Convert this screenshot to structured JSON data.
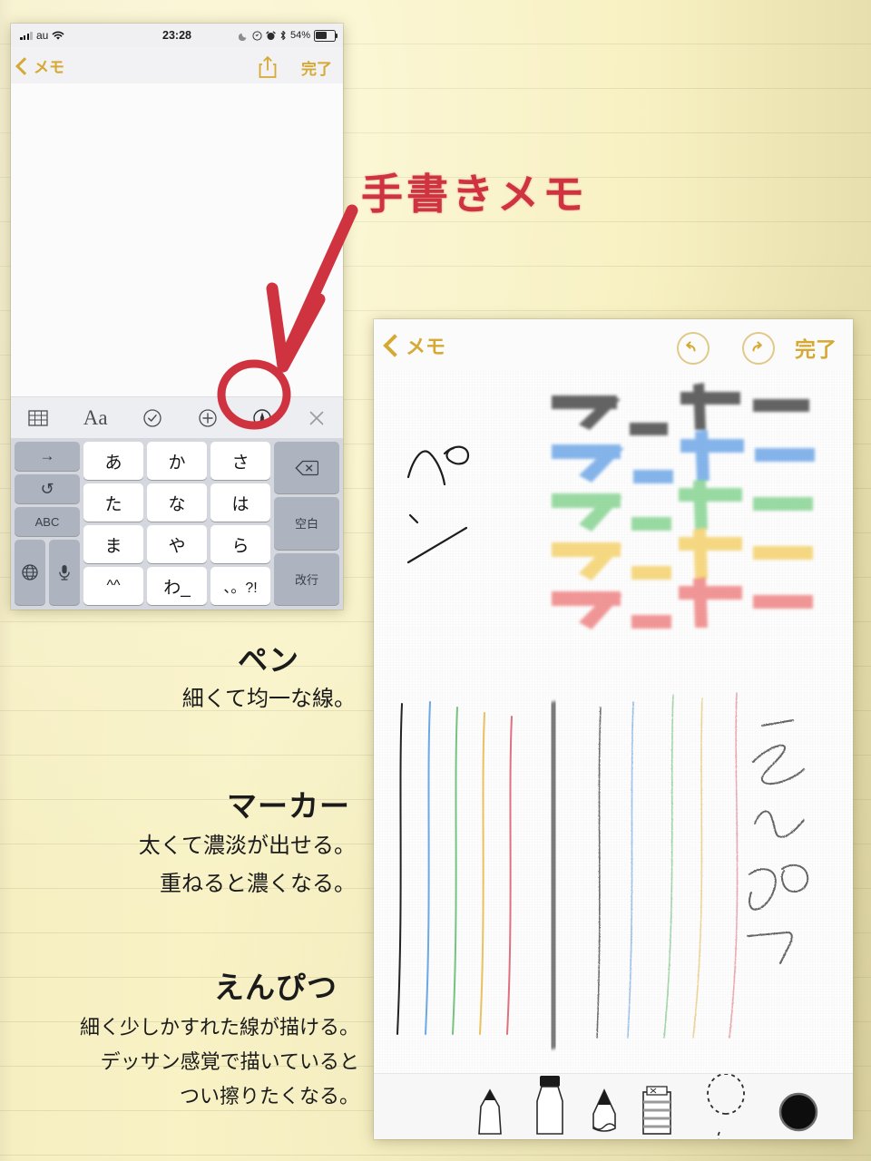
{
  "page": {
    "background_color": "#f8f2c4",
    "rule_color": "#96916e",
    "annotation_color": "#cf3340"
  },
  "annotation": {
    "title": "手書きメモ",
    "arrow": "red-arrow-down-left",
    "circle_target": "markup-pen-tool-icon"
  },
  "phone1": {
    "status_bar": {
      "signal_icon": "signal-bars-icon",
      "carrier": "au",
      "wifi_icon": "wifi-icon",
      "time": "23:28",
      "dnd_icon": "moon-icon",
      "location_icon": "location-icon",
      "alarm_icon": "alarm-clock-icon",
      "bluetooth_icon": "bluetooth-icon",
      "battery_percent": "54%",
      "battery_icon": "battery-icon"
    },
    "nav": {
      "back_label": "メモ",
      "back_icon": "chevron-left-icon",
      "share_icon": "share-icon",
      "done_label": "完了"
    },
    "toolbar": [
      {
        "name": "table-icon",
        "glyph": "table"
      },
      {
        "name": "format-text-icon",
        "glyph": "Aa"
      },
      {
        "name": "checklist-icon",
        "glyph": "check-circle"
      },
      {
        "name": "add-attachment-icon",
        "glyph": "plus-circle"
      },
      {
        "name": "markup-pen-icon",
        "glyph": "pen-circle"
      },
      {
        "name": "close-icon",
        "glyph": "x"
      }
    ],
    "keyboard": {
      "left_column": [
        "→",
        "↺",
        "ABC"
      ],
      "keys": [
        [
          "あ",
          "か",
          "さ"
        ],
        [
          "た",
          "な",
          "は"
        ],
        [
          "ま",
          "や",
          "ら"
        ],
        [
          "^^",
          "わ_",
          "、。?!"
        ]
      ],
      "right_column": [
        "⌫",
        "空白",
        "改行"
      ],
      "globe_icon": "globe-icon",
      "mic_icon": "microphone-icon"
    }
  },
  "phone2": {
    "nav": {
      "back_label": "メモ",
      "back_icon": "chevron-left-icon",
      "undo_icon": "undo-circle-icon",
      "redo_icon": "redo-circle-icon",
      "done_label": "完了"
    },
    "drawing": {
      "pen_sample_label": "ペン",
      "pencil_sample_label": "えんぴつ",
      "marker_word": "マーカー",
      "marker_colors": [
        "#4a4a4a",
        "#4a90e2",
        "#5cc46a",
        "#f2c94c",
        "#eb5757"
      ],
      "stroke_colors": [
        "#222222",
        "#6aa8e8",
        "#74c47f",
        "#e9c15e",
        "#e0707f"
      ]
    },
    "tools": [
      {
        "name": "pen-tool-icon",
        "selected": false
      },
      {
        "name": "marker-tool-icon",
        "selected": true
      },
      {
        "name": "pencil-tool-icon",
        "selected": false
      },
      {
        "name": "eraser-tool-icon",
        "selected": false
      },
      {
        "name": "lasso-tool-icon",
        "selected": false
      },
      {
        "name": "color-swatch-black",
        "selected": false,
        "color": "#0d0d0d"
      }
    ]
  },
  "descriptions": [
    {
      "heading": "ペン",
      "lines": [
        "細くて均一な線。"
      ]
    },
    {
      "heading": "マーカー",
      "lines": [
        "太くて濃淡が出せる。",
        "重ねると濃くなる。"
      ]
    },
    {
      "heading": "えんぴつ",
      "lines": [
        "細く少しかすれた線が描ける。",
        "デッサン感覚で描いていると",
        "つい擦りたくなる。"
      ]
    }
  ]
}
